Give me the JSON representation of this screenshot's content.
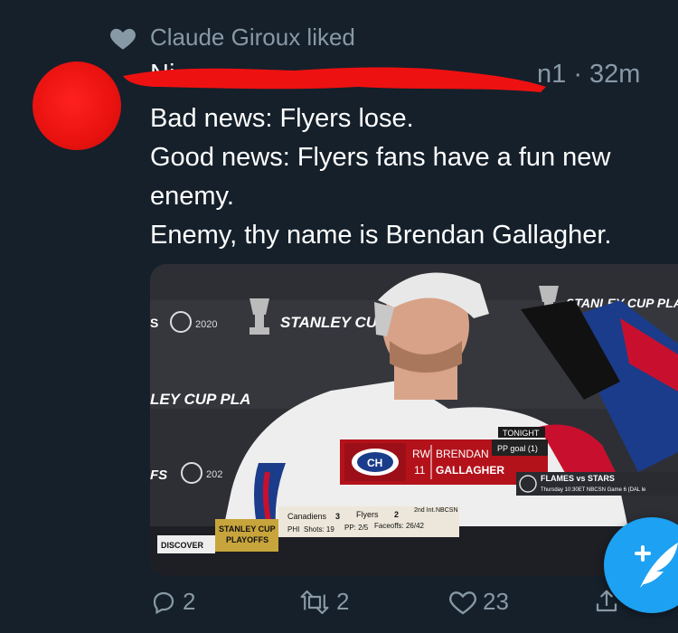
{
  "liked_by": {
    "text": "Claude Giroux liked"
  },
  "tweet": {
    "author_partial": "Ni",
    "handle_suffix": "n1 · 32m",
    "lines": [
      "Bad news: Flyers lose.",
      "Good news: Flyers fans have a fun new",
      "enemy.",
      "Enemy, thy name is Brendan Gallagher."
    ]
  },
  "media": {
    "backdrop": {
      "left_text": "LEY CUP PLA",
      "stanley_cup": "STANLEY CU",
      "year": "2020",
      "right_text": "STANLEY CUP PLAY",
      "fs_text": "FS",
      "year2": "202"
    },
    "lower_third": {
      "tonight": "TONIGHT",
      "position": "RW",
      "number": "11",
      "first_name": "BRENDAN",
      "last_name": "GALLAGHER",
      "stat": "PP goal (1)"
    },
    "scorebug": {
      "sponsor": "DISCOVER",
      "event_line1": "STANLEY CUP",
      "event_line2": "PLAYOFFS",
      "team1": "Canadiens",
      "score1": "3",
      "team2": "Flyers",
      "score2": "2",
      "period": "2nd Int.",
      "network": "NBCSN",
      "stats_team": "PHI",
      "shots": "Shots: 19",
      "pp": "PP: 2/5",
      "faceoffs": "Faceoffs: 26/42",
      "promo1": "FLAMES vs STARS",
      "promo2": "Thursday 10:30ET NBCSN Game 6 (DAL le"
    }
  },
  "actions": {
    "reply_count": "2",
    "retweet_count": "2",
    "like_count": "23"
  },
  "colors": {
    "background": "#15202b",
    "secondary_text": "#8899a6",
    "accent": "#1da1f2",
    "redaction": "#ee1111"
  }
}
